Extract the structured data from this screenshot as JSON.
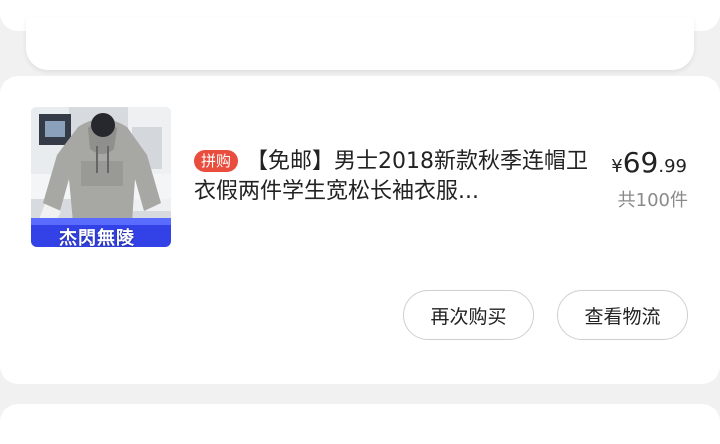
{
  "orders": {
    "item": {
      "group_buy_badge": "拼购",
      "title": "【免邮】男士2018新款秋季连帽卫衣假两件学生宽松长袖衣服...",
      "price_symbol": "¥",
      "price_integer": "69",
      "price_decimal": ".99",
      "quantity": "共100件",
      "image_banner_text": "杰閃無陵"
    },
    "actions": {
      "buy_again_label": "再次购买",
      "view_logistics_label": "查看物流"
    }
  },
  "colors": {
    "background": "#f1f1f1",
    "card": "#ffffff",
    "badge": "#e84d3d",
    "accent": "#e24b43",
    "muted_text": "#8a8a8a"
  }
}
